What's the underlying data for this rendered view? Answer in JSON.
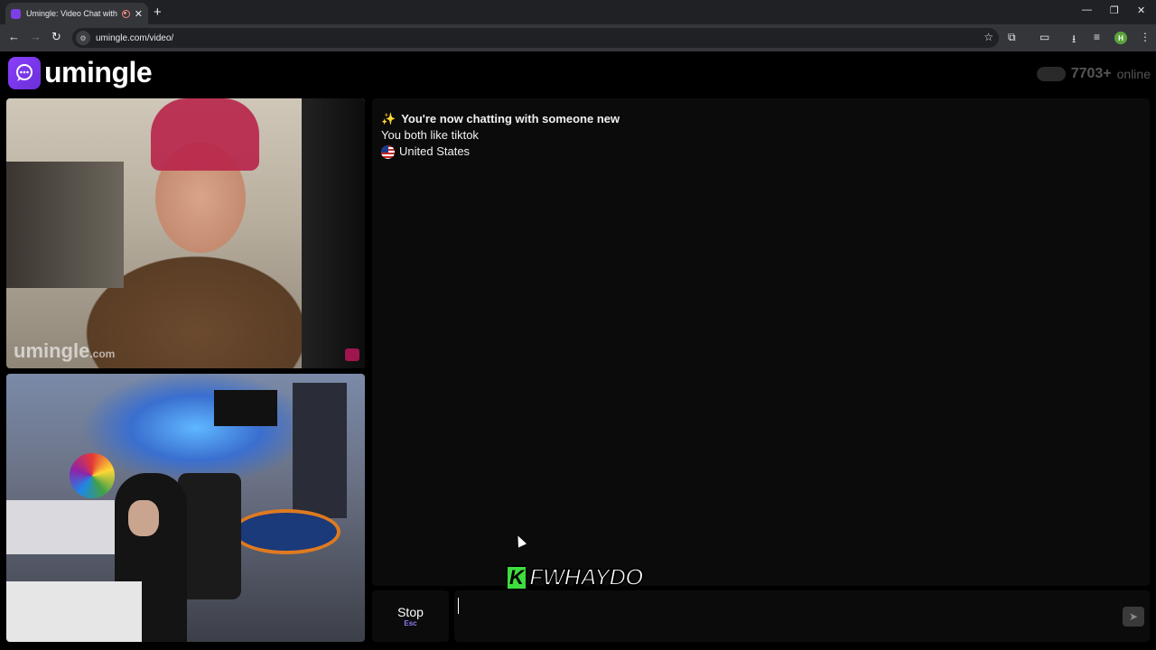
{
  "browser": {
    "tab_title": "Umingle: Video Chat with S",
    "url": "umingle.com/video/",
    "profile_initial": "H"
  },
  "header": {
    "logo_text": "umingle",
    "online_count": "7703+",
    "online_label": "online"
  },
  "video": {
    "watermark_text": "umingle",
    "watermark_suffix": ".com"
  },
  "chat": {
    "messages": [
      {
        "icon": "sparkle-icon",
        "text": "You're now chatting with someone new",
        "bold": true
      },
      {
        "text": "You both like tiktok"
      },
      {
        "icon": "us-flag-icon",
        "text": "United States"
      }
    ]
  },
  "controls": {
    "stop_label": "Stop",
    "stop_hint": "Esc",
    "message_placeholder": "",
    "send_icon": "send-icon"
  },
  "overlay": {
    "badge_letter": "K",
    "text": "FWHAYDO"
  },
  "colors": {
    "brand": "#7b3fe4",
    "background": "#000000",
    "panel": "#0b0b0b",
    "overlay_green": "#3fdc3f"
  }
}
